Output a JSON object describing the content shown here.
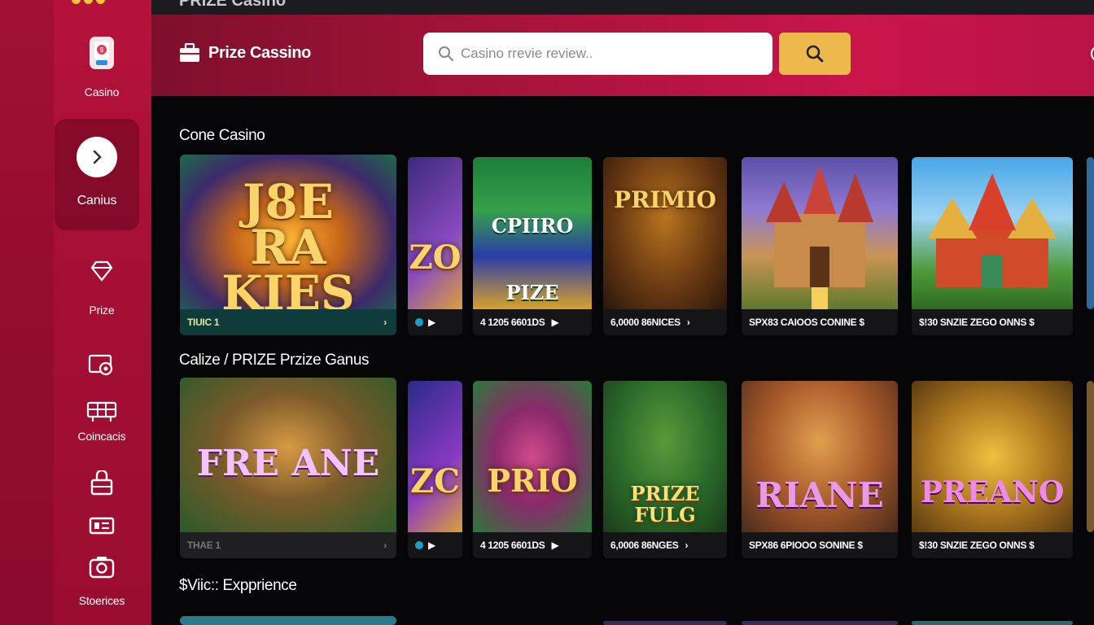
{
  "topbar": {
    "title": "PRIZE Casino"
  },
  "sidebar": {
    "items": [
      {
        "label": "Casino",
        "icon": "phone-casino-icon"
      },
      {
        "label": "Canius",
        "icon": "chevron-right-icon",
        "active": true
      },
      {
        "label": "Prize",
        "icon": "diamond-icon"
      },
      {
        "label": "",
        "icon": "screen-coin-icon"
      },
      {
        "label": "Coincacis",
        "icon": "cabinet-icon"
      },
      {
        "label": "",
        "icon": "bag-icon"
      },
      {
        "label": "",
        "icon": "ticket-icon"
      },
      {
        "label": "Stoerices",
        "icon": "camera-icon"
      }
    ]
  },
  "header": {
    "brand": "Prize Cassino",
    "search_placeholder": "Casino rrevie review..",
    "search_button_icon": "search-icon"
  },
  "sections": [
    {
      "title": "Cone Casino",
      "cards": [
        {
          "art_text": "J8E\nRA KIES",
          "footer": "TIUIC 1",
          "footer_style": "teal"
        },
        {
          "art_text": "ZO",
          "footer": "",
          "footer_style": "dot"
        },
        {
          "art_text": "CPIIRO\nPIZE",
          "footer": "4 1205 6601DS"
        },
        {
          "art_text": "PRIMIO",
          "footer": "6,0000 86NICES"
        },
        {
          "art_text": "",
          "footer": "SPX83 CAIOOS CONINE $"
        },
        {
          "art_text": "",
          "footer": "$!30 SNZIE ZEGO ONNS $"
        }
      ]
    },
    {
      "title": "Calize / PRIZE Przize Ganus",
      "cards": [
        {
          "art_text": "FRE  ANE",
          "footer": "THAE 1",
          "footer_style": "teal"
        },
        {
          "art_text": "ZC",
          "footer": "",
          "footer_style": "dot"
        },
        {
          "art_text": "PRIO",
          "footer": "4 1205 6601DS"
        },
        {
          "art_text": "PRIZE\nFULG",
          "footer": "6,0006 86NGES"
        },
        {
          "art_text": "RIANE",
          "footer": "SPX86 6PIOOO SONINE $"
        },
        {
          "art_text": "PREANO",
          "footer": "$!30 SNZIE ZEGO ONNS $"
        }
      ]
    },
    {
      "title": "$Viic:: Expprience"
    }
  ],
  "colors": {
    "accent": "#b5123a",
    "search_button": "#eeb94c",
    "background": "#050507"
  }
}
